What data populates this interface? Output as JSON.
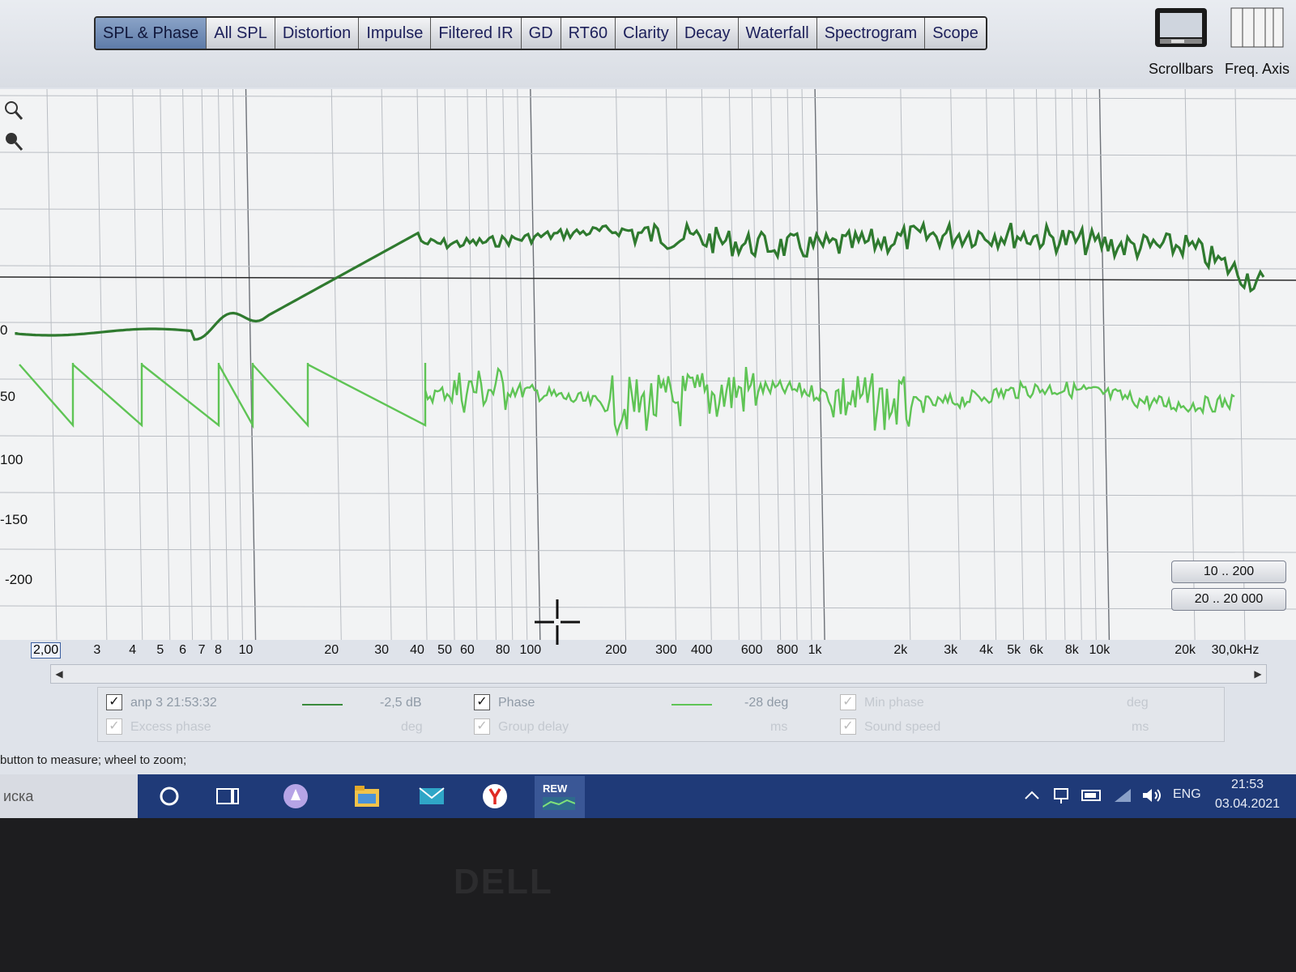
{
  "tabs": [
    {
      "label": "SPL & Phase",
      "active": true
    },
    {
      "label": "All SPL",
      "active": false
    },
    {
      "label": "Distortion",
      "active": false
    },
    {
      "label": "Impulse",
      "active": false
    },
    {
      "label": "Filtered IR",
      "active": false
    },
    {
      "label": "GD",
      "active": false
    },
    {
      "label": "RT60",
      "active": false
    },
    {
      "label": "Clarity",
      "active": false
    },
    {
      "label": "Decay",
      "active": false
    },
    {
      "label": "Waterfall",
      "active": false
    },
    {
      "label": "Spectrogram",
      "active": false
    },
    {
      "label": "Scope",
      "active": false
    }
  ],
  "toolbar": {
    "scrollbars_label": "Scrollbars",
    "freq_axis_label": "Freq. Axis"
  },
  "y_axis": {
    "ticks": [
      "0",
      "50",
      "100",
      "-150",
      "-200"
    ]
  },
  "range_buttons": {
    "phase_range": "10 .. 200",
    "freq_range": "20 .. 20 000"
  },
  "x_axis": {
    "start": "2,00",
    "ticks": [
      "3",
      "4",
      "5",
      "6",
      "7",
      "8",
      "10",
      "20",
      "30",
      "40",
      "50",
      "60",
      "80",
      "100",
      "200",
      "300",
      "400",
      "600",
      "800",
      "1k",
      "2k",
      "3k",
      "4k",
      "5k",
      "6k",
      "8k",
      "10k",
      "20k",
      "30,0kHz"
    ]
  },
  "legend": {
    "measurement_name": "anp 3 21:53:32",
    "spl_value": "-2,5 dB",
    "phase_label": "Phase",
    "phase_value": "-28 deg",
    "min_phase_label": "Min phase",
    "min_phase_unit": "deg",
    "excess_phase_label": "Excess phase",
    "excess_phase_unit": "deg",
    "spl_unit": "deg",
    "group_delay_label": "Group delay",
    "group_delay_unit": "ms",
    "sound_speed_label": "Sound speed",
    "sound_speed_unit": "ms"
  },
  "status_text": "button to measure; wheel to zoom;",
  "taskbar": {
    "search_text": "иска",
    "app_label": "REW",
    "lang": "ENG",
    "time": "21:53",
    "date": "03.04.2021"
  },
  "bezel": {
    "logo": "DELL"
  },
  "colors": {
    "spl": "#2f7a2f",
    "phase": "#5fc455",
    "accent": "#5e7ba8"
  }
}
